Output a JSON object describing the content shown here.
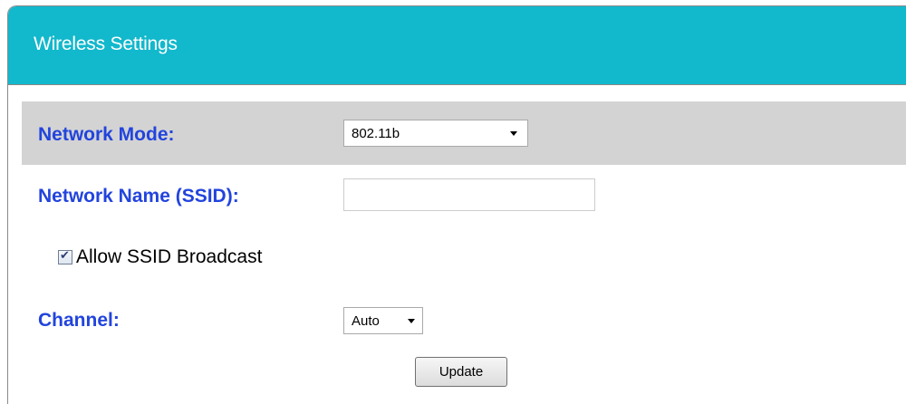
{
  "panel": {
    "title": "Wireless Settings"
  },
  "network_mode": {
    "label": "Network Mode:",
    "selected": "802.11b"
  },
  "ssid": {
    "label": "Network Name (SSID):",
    "value": ""
  },
  "broadcast": {
    "label": "Allow SSID Broadcast",
    "checked": true
  },
  "channel": {
    "label": "Channel:",
    "selected": "Auto"
  },
  "update": {
    "label": "Update"
  },
  "colors": {
    "header": "#12b8cc",
    "label_blue": "#2244dd",
    "row_shade": "#d3d3d3"
  }
}
